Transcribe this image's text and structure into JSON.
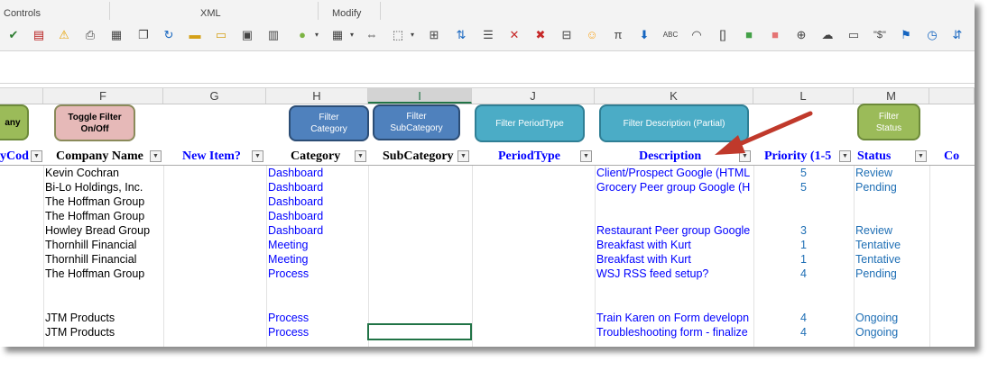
{
  "ribbon": {
    "groups": [
      "Controls",
      "XML",
      "Modify"
    ]
  },
  "columns": [
    "F",
    "G",
    "H",
    "I",
    "J",
    "K",
    "L",
    "M"
  ],
  "selected_column": "I",
  "filter_buttons": {
    "company": "any",
    "toggle": "Toggle Filter On/Off",
    "category": "Filter Category",
    "subcategory": "Filter SubCategory",
    "periodtype": "Filter PeriodType",
    "description": "Filter Description (Partial)",
    "status": "Filter Status"
  },
  "headers": {
    "code": "yCod",
    "company": "Company Name",
    "new_item": "New Item?",
    "category": "Category",
    "subcategory": "SubCategory",
    "periodtype": "PeriodType",
    "description": "Description",
    "priority": "Priority (1-5",
    "status": "Status",
    "next": "Co"
  },
  "rows": [
    {
      "company": "Kevin Cochran",
      "category": "Dashboard",
      "description": "Client/Prospect Google (HTML",
      "priority": "5",
      "status": "Review"
    },
    {
      "company": "Bi-Lo Holdings, Inc.",
      "category": "Dashboard",
      "description": "Grocery Peer group Google (H",
      "priority": "5",
      "status": "Pending"
    },
    {
      "company": "The Hoffman Group",
      "category": "Dashboard",
      "description": "",
      "priority": "",
      "status": ""
    },
    {
      "company": "The Hoffman Group",
      "category": "Dashboard",
      "description": "",
      "priority": "",
      "status": ""
    },
    {
      "company": "Howley Bread Group",
      "category": "Dashboard",
      "description": "Restaurant Peer group Google",
      "priority": "3",
      "status": "Review"
    },
    {
      "company": "Thornhill Financial",
      "category": "Meeting",
      "description": "Breakfast with Kurt",
      "priority": "1",
      "status": "Tentative"
    },
    {
      "company": "Thornhill Financial",
      "category": "Meeting",
      "description": "Breakfast with Kurt",
      "priority": "1",
      "status": "Tentative"
    },
    {
      "company": "The Hoffman Group",
      "category": "Process",
      "description": "WSJ RSS feed setup?",
      "priority": "4",
      "status": "Pending"
    },
    {
      "company": "JTM Products",
      "category": "Process",
      "description": "Train Karen on Form developn",
      "priority": "4",
      "status": "Ongoing"
    },
    {
      "company": "JTM Products",
      "category": "Process",
      "description": "Troubleshooting form - finalize",
      "priority": "4",
      "status": "Ongoing"
    }
  ],
  "colors": {
    "header_blue": "#0000ff",
    "status_teal": "#1f6fb5",
    "arrow_red": "#c0392b",
    "selection_green": "#217346"
  }
}
